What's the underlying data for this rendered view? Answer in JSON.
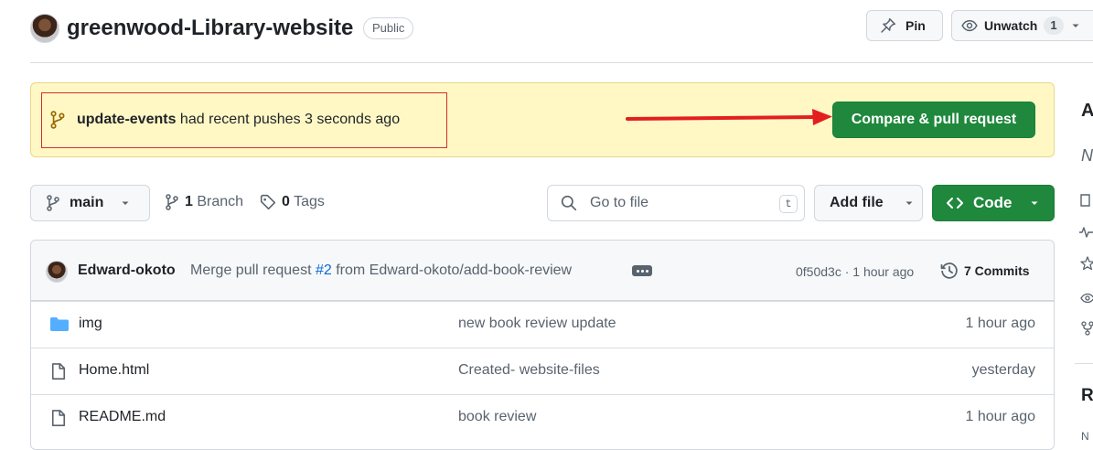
{
  "header": {
    "repo_name": "greenwood-Library-website",
    "visibility": "Public",
    "pin_label": "Pin",
    "unwatch_label": "Unwatch",
    "watch_count": "1"
  },
  "banner": {
    "branch": "update-events",
    "message": "had recent pushes 3 seconds ago",
    "compare_label": "Compare & pull request",
    "highlight_color": "#d12f2f",
    "arrow_color": "#e41e1e"
  },
  "toolbar": {
    "branch": "main",
    "branch_count": "1",
    "branch_word": "Branch",
    "tag_count": "0",
    "tag_word": "Tags",
    "search_placeholder": "Go to file",
    "search_shortcut": "t",
    "add_file_label": "Add file",
    "code_label": "Code"
  },
  "latest_commit": {
    "author": "Edward-okoto",
    "message_prefix": "Merge pull request",
    "pr_number": "#2",
    "message_suffix": "from Edward-okoto/add-book-review",
    "sha_time": "0f50d3c · 1 hour ago",
    "commits_label": "7 Commits"
  },
  "files": [
    {
      "name": "img",
      "type": "folder",
      "message": "new book review update",
      "date": "1 hour ago"
    },
    {
      "name": "Home.html",
      "type": "file",
      "message": "Created- website-files",
      "date": "yesterday"
    },
    {
      "name": "README.md",
      "type": "file",
      "message": "book review",
      "date": "1 hour ago"
    }
  ],
  "sidebar": {
    "about_initial": "A",
    "desc_initial": "N",
    "releases_initial": "R",
    "small_initial": "N"
  },
  "colors": {
    "primary_green": "#1f883d",
    "banner_yellow": "#fff8c5",
    "link_blue": "#0969da"
  }
}
